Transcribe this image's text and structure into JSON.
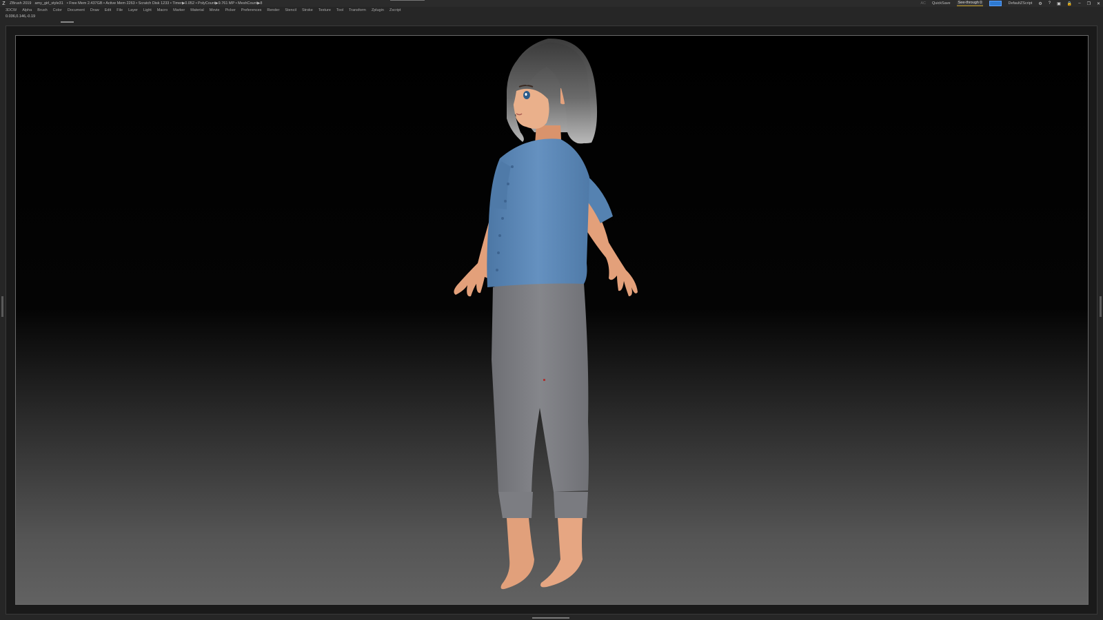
{
  "titlebar": {
    "app_name": "ZBrush 2019",
    "document_name": "amy_girl_style31",
    "stats": "• Free Mem 2.437GB • Active Mem 2263 • Scratch Disk 1233 • Timer▶0.052 • PolyCount▶9.761 MP • MeshCount▶8",
    "ac_label": "AC",
    "quicksave_label": "QuickSave",
    "see_through_label": "See-through",
    "see_through_value": "0",
    "script_label": "DefaultZScript"
  },
  "menu": [
    "3DCW",
    "Alpha",
    "Brush",
    "Color",
    "Document",
    "Draw",
    "Edit",
    "File",
    "Layer",
    "Light",
    "Macro",
    "Marker",
    "Material",
    "Movie",
    "Picker",
    "Preferences",
    "Render",
    "Stencil",
    "Stroke",
    "Texture",
    "Tool",
    "Transform",
    "Zplugin",
    "Zscript"
  ],
  "coordinates_readout": "0.036,0.146,-0.19",
  "colors": {
    "shirt": "#5b86b4",
    "pants": "#7a7b80",
    "skin": "#e7a57e",
    "hair": "#6a6a6a",
    "accent_script": "#2e7ad1"
  },
  "icons": [
    "zbrush-logo-icon",
    "help-icon",
    "lock-icon",
    "minimize-icon",
    "restore-icon",
    "close-icon"
  ]
}
